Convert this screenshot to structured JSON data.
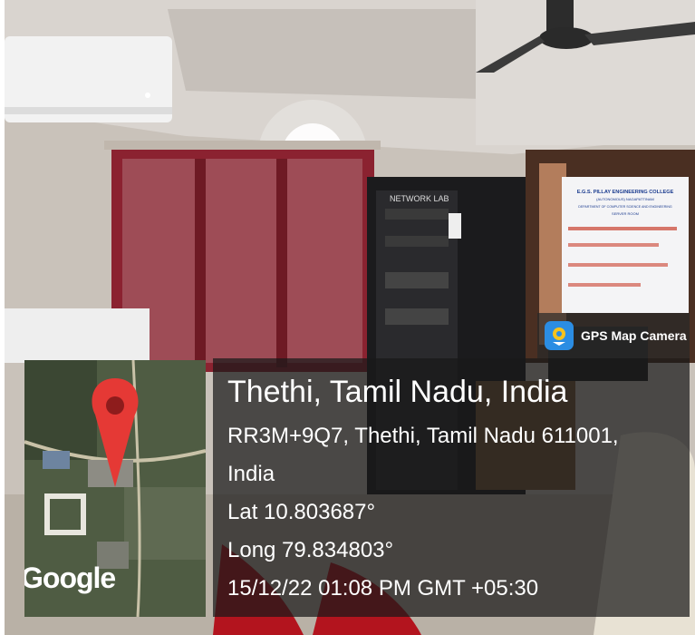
{
  "badge": {
    "label": "GPS Map Camera",
    "icon": "gps-map-camera-icon"
  },
  "location": {
    "title": "Thethi, Tamil Nadu, India",
    "address_line1": "RR3M+9Q7, Thethi, Tamil Nadu 611001,",
    "address_line2": "India",
    "lat": "Lat 10.803687°",
    "long": "Long 79.834803°",
    "timestamp": "15/12/22 01:08 PM GMT +05:30"
  },
  "map": {
    "watermark": "Google",
    "pin_color": "#e53935"
  },
  "sign": {
    "lines": [
      "E.G.S. PILLAY ENGINEERING COLLEGE",
      "(AUTONOMOUS) NAGAPATTINAM",
      "DEPARTMENT OF COMPUTER SCIENCE AND ENGINEERING",
      "SERVER ROOM"
    ],
    "text_color": "#1a3b8f"
  },
  "rack_label": "NETWORK LAB"
}
